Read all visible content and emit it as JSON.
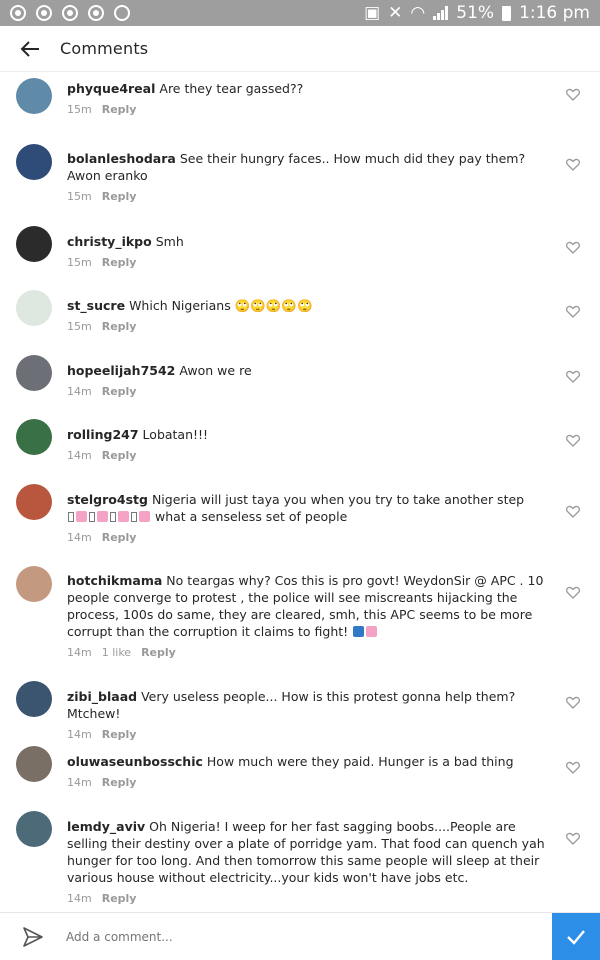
{
  "status_bar": {
    "battery": "51%",
    "time": "1:16 pm"
  },
  "header": {
    "title": "Comments"
  },
  "comments": [
    {
      "username": "phyque4real",
      "text": "Are they tear gassed??",
      "time": "15m",
      "reply": "Reply",
      "avatar_color": "#5f8aa8"
    },
    {
      "username": "bolanleshodara",
      "text": "See their hungry faces.. How much did they pay them? Awon eranko",
      "time": "15m",
      "reply": "Reply",
      "avatar_color": "#2f4b78"
    },
    {
      "username": "christy_ikpo",
      "text": "Smh",
      "time": "15m",
      "reply": "Reply",
      "avatar_color": "#2b2b2b"
    },
    {
      "username": "st_sucre",
      "text": "Which Nigerians 🙄🙄🙄🙄🙄",
      "time": "15m",
      "reply": "Reply",
      "avatar_color": "#dfe8e0"
    },
    {
      "username": "hopeelijah7542",
      "text": "Awon we re",
      "time": "14m",
      "reply": "Reply",
      "avatar_color": "#6d6f76"
    },
    {
      "username": "rolling247",
      "text": "Lobatan!!!",
      "time": "14m",
      "reply": "Reply",
      "avatar_color": "#3a7046"
    },
    {
      "username": "stelgro4stg",
      "text": "Nigeria will just taya you when you try to take another step",
      "text_after_emoji": "what a senseless set of people",
      "time": "14m",
      "reply": "Reply",
      "avatar_color": "#b8573d"
    },
    {
      "username": "hotchikmama",
      "text": "No teargas why? Cos this is pro govt! WeydonSir @ APC . 10 people converge to protest , the police will see miscreants hijacking the process, 100s do same, they are cleared, smh, this APC seems to be more corrupt than the corruption it claims to fight!",
      "time": "14m",
      "likes": "1 like",
      "reply": "Reply",
      "avatar_color": "#c39a80"
    },
    {
      "username": "zibi_blaad",
      "text": "Very useless people... How is this protest gonna help them? Mtchew!",
      "time": "14m",
      "reply": "Reply",
      "avatar_color": "#3b5470"
    },
    {
      "username": "oluwaseunbosschic",
      "text": "How much were they paid. Hunger is a bad thing",
      "time": "14m",
      "reply": "Reply",
      "avatar_color": "#7a6f65"
    },
    {
      "username": "lemdy_aviv",
      "text": "Oh Nigeria! I weep for her fast sagging boobs....People are selling their destiny over a plate of porridge yam. That food can quench yah hunger for too long. And then tomorrow this same people will sleep at their various house without electricity...your kids won't have jobs etc.",
      "time": "14m",
      "reply": "Reply",
      "avatar_color": "#4d6a78"
    }
  ],
  "composer": {
    "placeholder": "Add a comment..."
  },
  "colors": {
    "status_bar": "#9e9e9e",
    "accent": "#2d8ee8",
    "meta_text": "#999999"
  }
}
